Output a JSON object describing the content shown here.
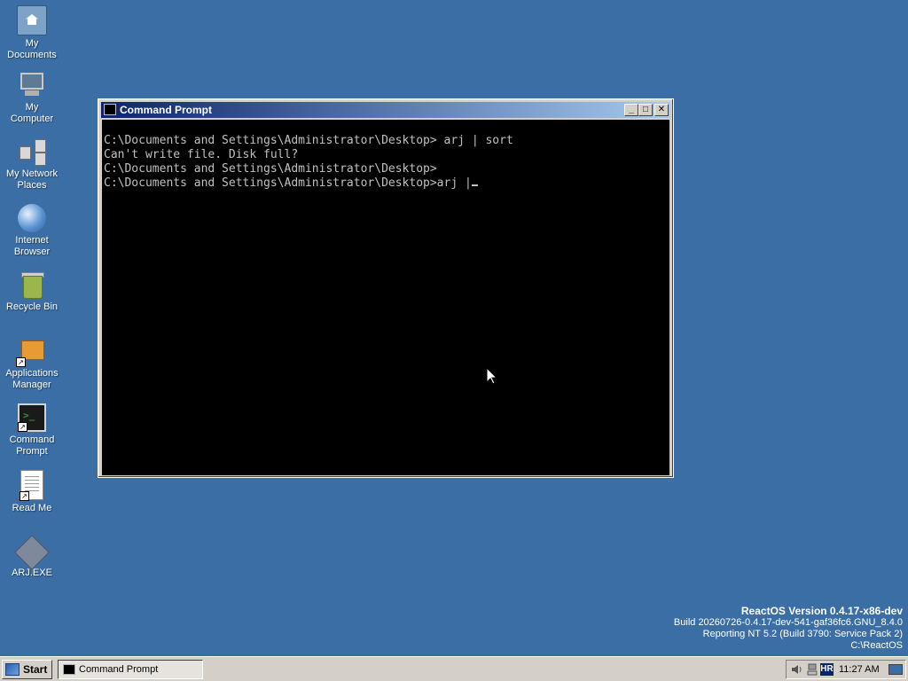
{
  "desktop": {
    "icons": [
      {
        "label": "My\nDocuments",
        "icon": "my-documents-icon"
      },
      {
        "label": "My\nComputer",
        "icon": "my-computer-icon"
      },
      {
        "label": "My Network\nPlaces",
        "icon": "network-places-icon"
      },
      {
        "label": "Internet\nBrowser",
        "icon": "internet-browser-icon"
      },
      {
        "label": "Recycle Bin",
        "icon": "recycle-bin-icon"
      },
      {
        "label": "Applications\nManager",
        "icon": "applications-manager-icon"
      },
      {
        "label": "Command\nPrompt",
        "icon": "command-prompt-icon"
      },
      {
        "label": "Read Me",
        "icon": "read-me-icon"
      },
      {
        "label": "ARJ.EXE",
        "icon": "arj-exe-icon"
      }
    ],
    "background_color": "#3a6ea5"
  },
  "window": {
    "title": "Command Prompt",
    "buttons": {
      "minimize": "_",
      "maximize": "□",
      "close": "✕"
    },
    "console_lines": [
      "C:\\Documents and Settings\\Administrator\\Desktop> arj | sort",
      "Can't write file. Disk full?",
      "C:\\Documents and Settings\\Administrator\\Desktop>",
      "C:\\Documents and Settings\\Administrator\\Desktop>arj |"
    ]
  },
  "version_info": {
    "line1": "ReactOS Version 0.4.17-x86-dev",
    "line2": "Build 20260726-0.4.17-dev-541-gaf36fc6.GNU_8.4.0",
    "line3": "Reporting NT 5.2 (Build 3790: Service Pack 2)",
    "line4": "C:\\ReactOS"
  },
  "taskbar": {
    "start_label": "Start",
    "tasks": [
      {
        "label": "Command Prompt"
      }
    ],
    "tray": {
      "language": "HR",
      "clock": "11:27 AM"
    }
  }
}
